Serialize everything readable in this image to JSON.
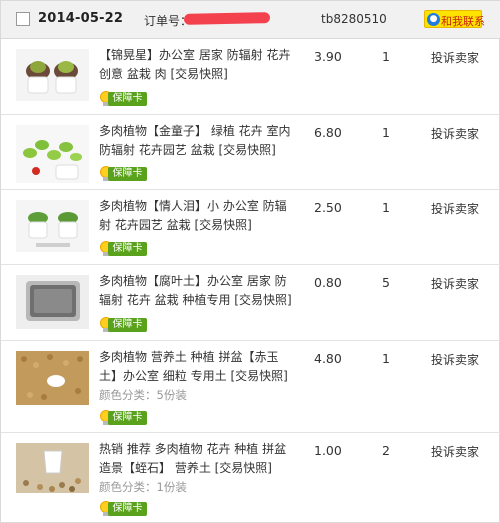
{
  "header": {
    "date": "2014-05-22",
    "order_label": "订单号：",
    "tb_id": "tb8280510",
    "contact_label": "和我联系"
  },
  "badge_label": "保障卡",
  "orders": [
    {
      "title": "【锦晃星】办公室 居家 防辐射 花卉 创意 盆栽 肉 [交易快照]",
      "price": "3.90",
      "qty": "1",
      "action": "投诉卖家",
      "spec": ""
    },
    {
      "title": "多肉植物【金童子】 绿植 花卉 室内 防辐射 花卉园艺 盆栽 [交易快照]",
      "price": "6.80",
      "qty": "1",
      "action": "投诉卖家",
      "spec": ""
    },
    {
      "title": "多肉植物【情人泪】小 办公室 防辐射 花卉园艺 盆栽 [交易快照]",
      "price": "2.50",
      "qty": "1",
      "action": "投诉卖家",
      "spec": ""
    },
    {
      "title": "多肉植物【腐叶土】办公室 居家 防辐射 花卉 盆栽 种植专用 [交易快照]",
      "price": "0.80",
      "qty": "5",
      "action": "投诉卖家",
      "spec": ""
    },
    {
      "title": "多肉植物 营养土 种植 拼盆【赤玉土】办公室 细粒 专用土 [交易快照]",
      "price": "4.80",
      "qty": "1",
      "action": "投诉卖家",
      "spec": "颜色分类：5份装"
    },
    {
      "title": "热销 推荐 多肉植物 花卉 种植 拼盆 造景【蛭石】 营养土 [交易快照]",
      "price": "1.00",
      "qty": "2",
      "action": "投诉卖家",
      "spec": "颜色分类：1份装"
    }
  ]
}
